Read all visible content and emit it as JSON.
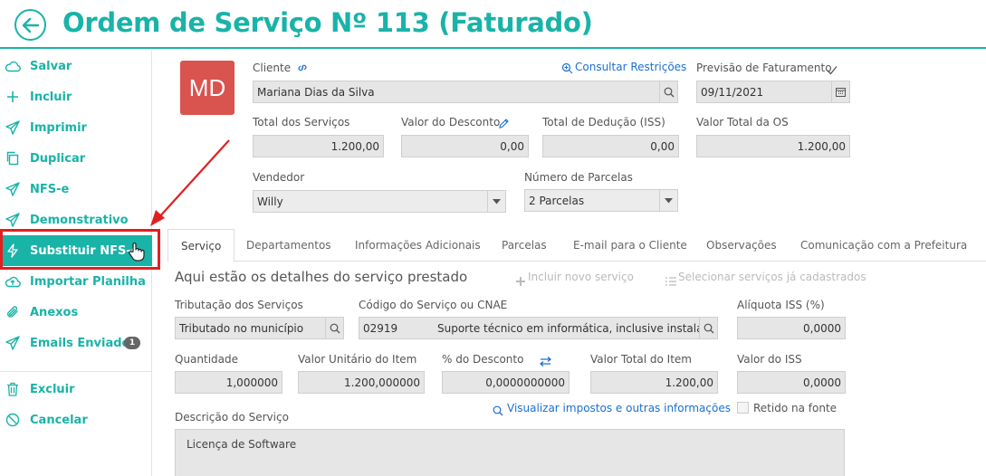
{
  "header": {
    "title": "Ordem de Serviço Nº 113 (Faturado)"
  },
  "sidebar": {
    "items": [
      {
        "label": "Salvar"
      },
      {
        "label": "Incluir"
      },
      {
        "label": "Imprimir"
      },
      {
        "label": "Duplicar"
      },
      {
        "label": "NFS-e"
      },
      {
        "label": "Demonstrativo"
      },
      {
        "label": "Substituir NFS-e"
      },
      {
        "label": "Importar Planilha"
      },
      {
        "label": "Anexos"
      },
      {
        "label": "Emails Enviados",
        "badge": "1"
      },
      {
        "label": "Excluir"
      },
      {
        "label": "Cancelar"
      }
    ]
  },
  "client": {
    "avatar_initials": "MD",
    "label": "Cliente",
    "value": "Mariana Dias da Silva",
    "consult_link": "Consultar Restrições"
  },
  "billing_forecast": {
    "label": "Previsão de Faturamento",
    "value": "09/11/2021"
  },
  "totals": {
    "services_label": "Total dos Serviços",
    "services_value": "1.200,00",
    "discount_label": "Valor do Desconto",
    "discount_value": "0,00",
    "deduction_label": "Total de Dedução (ISS)",
    "deduction_value": "0,00",
    "total_label": "Valor Total da OS",
    "total_value": "1.200,00"
  },
  "seller": {
    "label": "Vendedor",
    "value": "Willy"
  },
  "installments": {
    "label": "Número de Parcelas",
    "value": "2 Parcelas"
  },
  "tabs": [
    {
      "label": "Serviço"
    },
    {
      "label": "Departamentos"
    },
    {
      "label": "Informações Adicionais"
    },
    {
      "label": "Parcelas"
    },
    {
      "label": "E-mail para o Cliente"
    },
    {
      "label": "Observações"
    },
    {
      "label": "Comunicação com a Prefeitura"
    }
  ],
  "service": {
    "section_title": "Aqui estão os detalhes do serviço prestado",
    "add_new": "Incluir novo serviço",
    "select_existing": "Selecionar serviços já cadastrados",
    "taxation_label": "Tributação dos Serviços",
    "taxation_value": "Tributado no município",
    "code_label": "Código do Serviço ou CNAE",
    "code_value": "02919",
    "code_desc": "Suporte técnico em informática, inclusive instalação",
    "iss_rate_label": "Alíquota ISS (%)",
    "iss_rate_value": "0,0000",
    "qty_label": "Quantidade",
    "qty_value": "1,000000",
    "unit_label": "Valor Unitário do Item",
    "unit_value": "1.200,000000",
    "disc_pct_label": "% do Desconto",
    "disc_pct_value": "0,0000000000",
    "item_total_label": "Valor Total do Item",
    "item_total_value": "1.200,00",
    "iss_value_label": "Valor do ISS",
    "iss_value_value": "0,0000",
    "desc_label": "Descrição do Serviço",
    "taxes_link": "Visualizar impostos e outras informações",
    "withheld_label": "Retido na fonte",
    "desc_value": "Licença de Software"
  }
}
